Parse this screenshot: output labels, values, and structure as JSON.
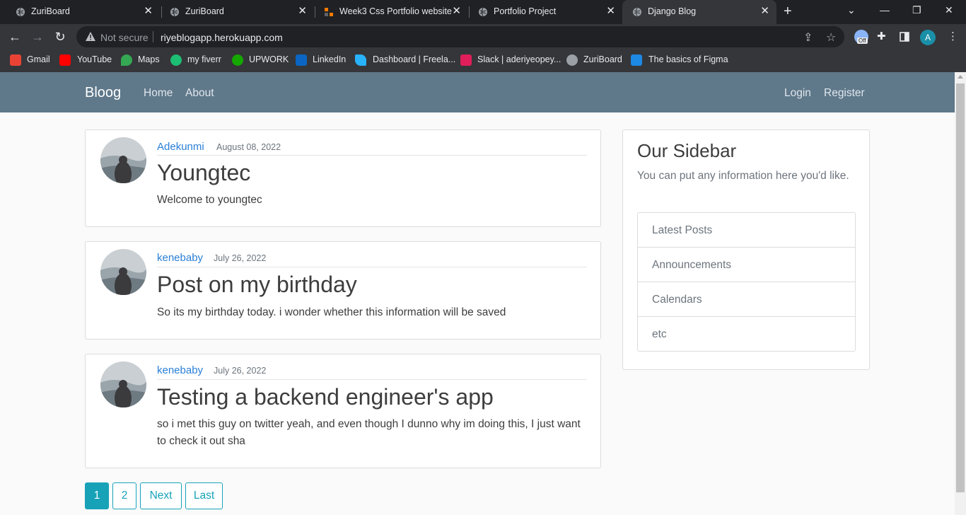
{
  "browser": {
    "tabs": [
      {
        "title": "ZuriBoard",
        "active": false
      },
      {
        "title": "ZuriBoard",
        "active": false
      },
      {
        "title": "Week3 Css Portfolio website",
        "active": false
      },
      {
        "title": "Portfolio Project",
        "active": false
      },
      {
        "title": "Django Blog",
        "active": true
      }
    ],
    "new_tab_glyph": "+",
    "close_glyph": "✕",
    "address": {
      "security_label": "Not secure",
      "url": "riyeblogapp.herokuapp.com"
    },
    "profile_initial": "A",
    "extension_badge": "Off",
    "bookmarks": [
      {
        "label": "Gmail",
        "color": "#ea4335"
      },
      {
        "label": "YouTube",
        "color": "#ff0000"
      },
      {
        "label": "Maps",
        "color": "#34a853"
      },
      {
        "label": "my fiverr",
        "color": "#1dbf73"
      },
      {
        "label": "UPWORK",
        "color": "#14a800"
      },
      {
        "label": "LinkedIn",
        "color": "#0a66c2"
      },
      {
        "label": "Dashboard | Freela...",
        "color": "#29b2fe"
      },
      {
        "label": "Slack | aderiyeopey...",
        "color": "#e01e5a"
      },
      {
        "label": "ZuriBoard",
        "color": "#9aa0a6"
      },
      {
        "label": "The basics of Figma",
        "color": "#1e88e5"
      }
    ]
  },
  "site": {
    "brand": "Bloog",
    "nav_left": [
      "Home",
      "About"
    ],
    "nav_right": [
      "Login",
      "Register"
    ],
    "posts": [
      {
        "author": "Adekunmi",
        "date": "August 08, 2022",
        "title": "Youngtec",
        "body": "Welcome to youngtec"
      },
      {
        "author": "kenebaby",
        "date": "July 26, 2022",
        "title": "Post on my birthday",
        "body": "So its my birthday today. i wonder whether this information will be saved"
      },
      {
        "author": "kenebaby",
        "date": "July 26, 2022",
        "title": "Testing a backend engineer's app",
        "body": "so i met this guy on twitter yeah, and even though I dunno why im doing this, I just want to check it out sha"
      }
    ],
    "sidebar": {
      "title": "Our Sidebar",
      "text": "You can put any information here you'd like.",
      "items": [
        "Latest Posts",
        "Announcements",
        "Calendars",
        "etc"
      ]
    },
    "pagination": [
      "1",
      "2",
      "Next",
      "Last"
    ],
    "accent": "#17a2b8",
    "navbar_color": "#5f788a"
  }
}
